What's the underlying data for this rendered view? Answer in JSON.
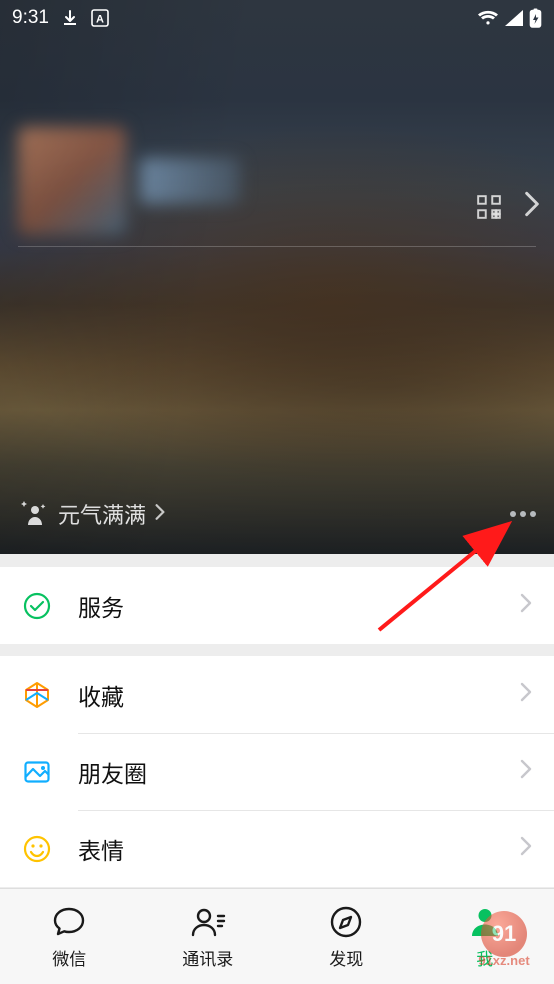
{
  "status_bar": {
    "time": "9:31",
    "icons_left": [
      "download-icon",
      "letter-a-icon"
    ],
    "icons_right": [
      "wifi-icon",
      "signal-icon",
      "battery-icon"
    ]
  },
  "cover": {
    "status_text": "元气满满",
    "qr_icon": "qr-icon",
    "chevron_icon": "chevron-right-icon",
    "more_icon": "more-icon",
    "sparkle_icon": "sparkle-person-icon"
  },
  "menu": {
    "group1": [
      {
        "icon": "service-icon",
        "label": "服务",
        "color": "#07c160"
      }
    ],
    "group2": [
      {
        "icon": "favorites-icon",
        "label": "收藏",
        "color": "#e64340"
      },
      {
        "icon": "moments-icon",
        "label": "朋友圈",
        "color": "#10aeff"
      },
      {
        "icon": "sticker-icon",
        "label": "表情",
        "color": "#ffc300"
      }
    ]
  },
  "tabs": [
    {
      "icon": "chat-icon",
      "label": "微信",
      "active": false
    },
    {
      "icon": "contacts-icon",
      "label": "通讯录",
      "active": false
    },
    {
      "icon": "discover-icon",
      "label": "发现",
      "active": false
    },
    {
      "icon": "me-icon",
      "label": "我",
      "active": true
    }
  ],
  "watermark": {
    "badge": "91",
    "text": "91xz.net"
  },
  "annotation": {
    "arrow": "red-arrow-to-more-icon"
  }
}
